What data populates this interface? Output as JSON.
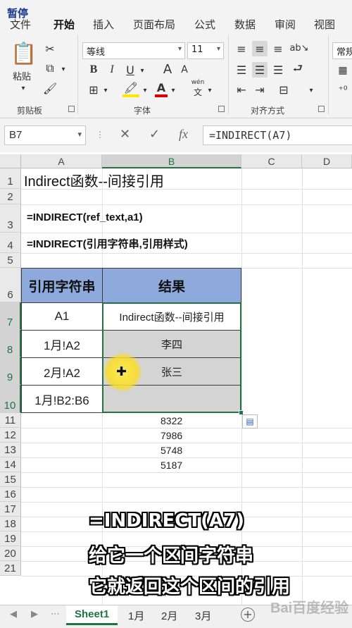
{
  "overlay": {
    "pause_badge": "暂停"
  },
  "ribbon": {
    "tabs": [
      "文件",
      "开始",
      "插入",
      "页面布局",
      "公式",
      "数据",
      "审阅",
      "视图"
    ],
    "active_tab": "开始",
    "clipboard": {
      "paste_label": "粘贴",
      "group_label": "剪贴板"
    },
    "font": {
      "name": "等线",
      "size": "11",
      "bold": "B",
      "italic": "I",
      "underline": "U",
      "grow": "A",
      "shrink": "A",
      "pinyin": "wén",
      "pinyin_sub": "文",
      "group_label": "字体"
    },
    "alignment": {
      "group_label": "对齐方式"
    },
    "number": {
      "format": "常规"
    }
  },
  "formula_bar": {
    "name_box": "B7",
    "cancel_icon": "✕",
    "enter_icon": "✓",
    "fx_label": "fx",
    "formula": "=INDIRECT(A7)"
  },
  "grid": {
    "columns": [
      "A",
      "B",
      "C",
      "D"
    ],
    "selected_column": "B",
    "rows": [
      "1",
      "2",
      "3",
      "4",
      "5",
      "6",
      "7",
      "8",
      "9",
      "10",
      "11",
      "12",
      "13",
      "14",
      "15",
      "16",
      "17",
      "18",
      "19",
      "20",
      "21"
    ],
    "title": "Indirect函数--间接引用",
    "formula_line_1": "=INDIRECT(ref_text,a1)",
    "formula_line_2": "=INDIRECT(引用字符串,引用样式)",
    "table": {
      "header_a": "引用字符串",
      "header_b": "结果",
      "rows": [
        {
          "a": "A1",
          "b": "Indirect函数--间接引用"
        },
        {
          "a": "1月!A2",
          "b": "李四"
        },
        {
          "a": "2月!A2",
          "b": "张三"
        },
        {
          "a": "1月!B2:B6",
          "b": ""
        }
      ]
    },
    "spill_values": [
      "8322",
      "7986",
      "5748",
      "5187"
    ]
  },
  "subtitles": [
    "=INDIRECT(A7)",
    "给它一个区间字符串",
    "它就返回这个区间的引用"
  ],
  "sheets": {
    "tabs": [
      "Sheet1",
      "1月",
      "2月",
      "3月"
    ],
    "active": "Sheet1",
    "add_label": "+"
  },
  "watermark": "Bai百度经验",
  "colors": {
    "accent": "#217346",
    "header_fill": "#8ea9db",
    "result_fill": "#d4d4d4"
  }
}
